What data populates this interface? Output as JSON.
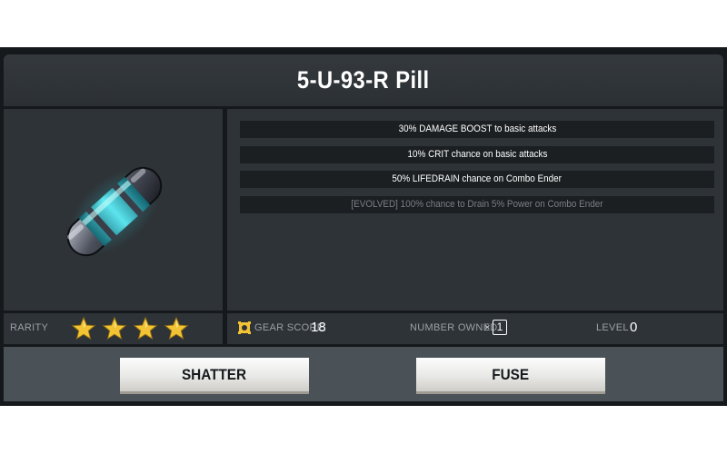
{
  "item": {
    "name": "5-U-93-R Pill",
    "icon": "pill-capsule-icon"
  },
  "stats": [
    {
      "text": "30% DAMAGE BOOST to basic attacks"
    },
    {
      "text": "10% CRIT chance on basic attacks"
    },
    {
      "text": "50% LIFEDRAIN chance on Combo Ender"
    },
    {
      "text": "[EVOLVED] 100% chance to Drain 5% Power on Combo Ender",
      "evolved": true
    }
  ],
  "rarity": {
    "label": "RARITY",
    "stars": 4,
    "star_icon": "gold-star-icon"
  },
  "info": {
    "gear_score_label": "GEAR SCORE",
    "gear_score_value": "18",
    "gear_icon": "gear-score-icon",
    "owned_label": "NUMBER OWNED",
    "owned_prefix": "×",
    "owned_value": "1",
    "level_label": "LEVEL",
    "level_value": "0"
  },
  "actions": {
    "shatter_label": "SHATTER",
    "fuse_label": "FUSE"
  },
  "colors": {
    "panel": "#2e3337",
    "stat_row": "#1b1f22",
    "accent_gold": "#f2c335",
    "pill_glow": "#33e6f0"
  }
}
